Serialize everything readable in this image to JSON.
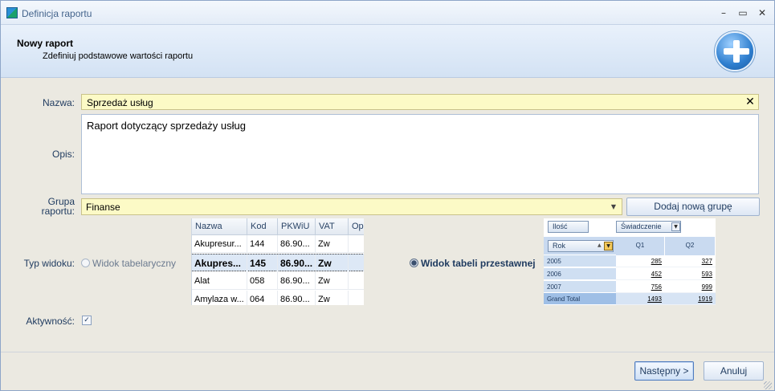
{
  "window": {
    "title": "Definicja raportu",
    "minimize_glyph": "–",
    "maximize_glyph": "▭",
    "close_glyph": "✕"
  },
  "header": {
    "title": "Nowy raport",
    "subtitle": "Zdefiniuj podstawowe wartości raportu",
    "icon": "add-plus-icon"
  },
  "form": {
    "name_label": "Nazwa:",
    "name_value": "Sprzedaż usług",
    "clear_glyph": "✕",
    "description_label": "Opis:",
    "description_value": "Raport dotyczący sprzedaży usług",
    "group_label_line1": "Grupa",
    "group_label_line2": "raportu:",
    "group_value": "Finanse",
    "group_arrow": "▼",
    "add_group_button": "Dodaj nową grupę",
    "view_type_label": "Typ widoku:",
    "view_table_option": "Widok tabelaryczny",
    "view_pivot_option": "Widok tabeli przestawnej",
    "selected_view": "pivot",
    "active_label": "Aktywność:",
    "active_checked": true,
    "check_glyph": "✓"
  },
  "table_preview": {
    "columns": [
      "Nazwa",
      "Kod",
      "PKWiU",
      "VAT",
      "Opi"
    ],
    "rows": [
      [
        "Akupresur...",
        "144",
        "86.90...",
        "Zw",
        ""
      ],
      [
        "Akupres...",
        "145",
        "86.90...",
        "Zw",
        ""
      ],
      [
        "Alat",
        "058",
        "86.90...",
        "Zw",
        ""
      ],
      [
        "Amylaza w...",
        "064",
        "86.90...",
        "Zw",
        ""
      ]
    ],
    "selected_row": 1
  },
  "pivot_preview": {
    "data_field": "Ilość",
    "column_field": "Świadczenie",
    "row_field": "Rok",
    "column_headers": [
      "Q1",
      "Q2"
    ],
    "rows": [
      {
        "label": "2005",
        "values": [
          "285",
          "327"
        ]
      },
      {
        "label": "2006",
        "values": [
          "452",
          "593"
        ]
      },
      {
        "label": "2007",
        "values": [
          "756",
          "999"
        ]
      },
      {
        "label": "Grand Total",
        "values": [
          "1493",
          "1919"
        ]
      }
    ],
    "dropdown_glyph": "▼",
    "sort_glyph": "▲"
  },
  "footer": {
    "next_button": "Następny >",
    "cancel_button": "Anuluj"
  },
  "colors": {
    "accent": "#4f7cc0",
    "input_highlight": "#fcfac6",
    "header_bg": "#d3e2f4"
  }
}
